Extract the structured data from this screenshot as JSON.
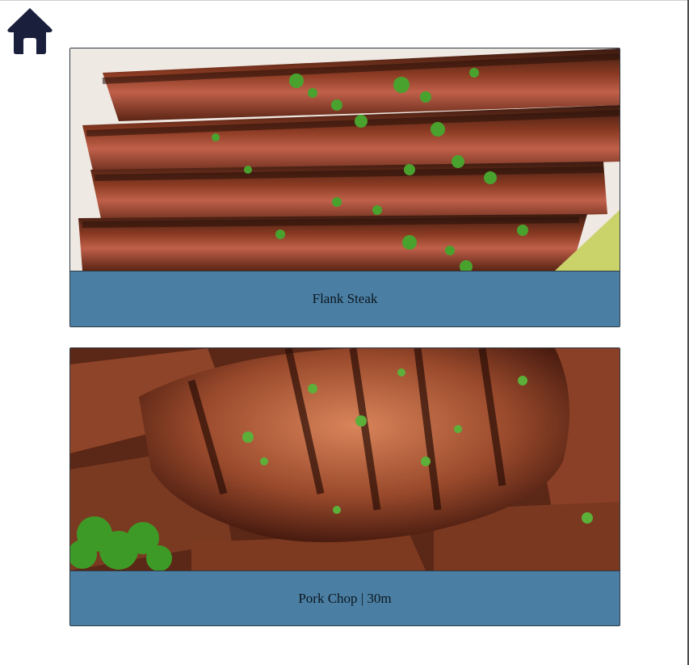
{
  "nav": {
    "home_icon": "home-icon"
  },
  "recipes": [
    {
      "title": "Flank Steak",
      "image": "flank-steak-photo"
    },
    {
      "title": "Pork Chop | 30m",
      "image": "pork-chop-photo"
    }
  ],
  "colors": {
    "caption_bg": "#4a7fa3",
    "home_icon": "#1a1f3c",
    "card_border": "#2f3a45"
  }
}
